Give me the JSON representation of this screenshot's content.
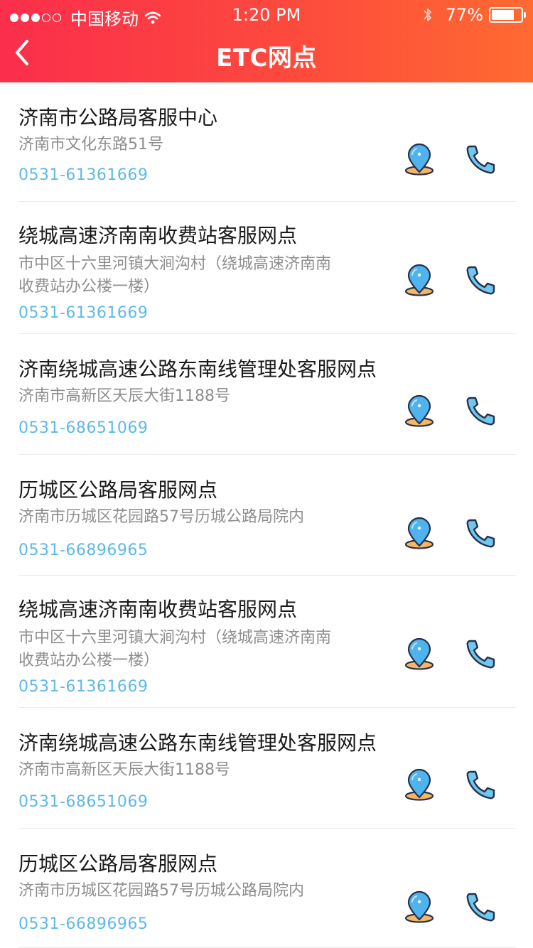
{
  "status_bar": {
    "carrier": "中国移动",
    "time": "1:20 PM",
    "battery_text": "77%",
    "battery_level": 0.77
  },
  "nav": {
    "title": "ETC网点",
    "back_icon": "chevron-left-icon"
  },
  "colors": {
    "header_gradient_start": "#fb2e4c",
    "header_gradient_end": "#ff6a31",
    "phone_text": "#5fb9e6",
    "address_text": "#8e8e8e"
  },
  "icons": {
    "location": "map-pin-icon",
    "call": "phone-icon"
  },
  "locations": [
    {
      "name": "济南市公路局客服中心",
      "address": "济南市文化东路51号",
      "phone": "0531-61361669"
    },
    {
      "name": "绕城高速济南南收费站客服网点",
      "address": "市中区十六里河镇大涧沟村（绕城高速济南南收费站办公楼一楼）",
      "phone": "0531-61361669"
    },
    {
      "name": "济南绕城高速公路东南线管理处客服网点",
      "address": "济南市高新区天辰大街1188号",
      "phone": "0531-68651069"
    },
    {
      "name": "历城区公路局客服网点",
      "address": "济南市历城区花园路57号历城公路局院内",
      "phone": "0531-66896965"
    },
    {
      "name": "绕城高速济南南收费站客服网点",
      "address": "市中区十六里河镇大涧沟村（绕城高速济南南收费站办公楼一楼）",
      "phone": "0531-61361669"
    },
    {
      "name": "济南绕城高速公路东南线管理处客服网点",
      "address": "济南市高新区天辰大街1188号",
      "phone": "0531-68651069"
    },
    {
      "name": "历城区公路局客服网点",
      "address": "济南市历城区花园路57号历城公路局院内",
      "phone": "0531-66896965"
    }
  ]
}
